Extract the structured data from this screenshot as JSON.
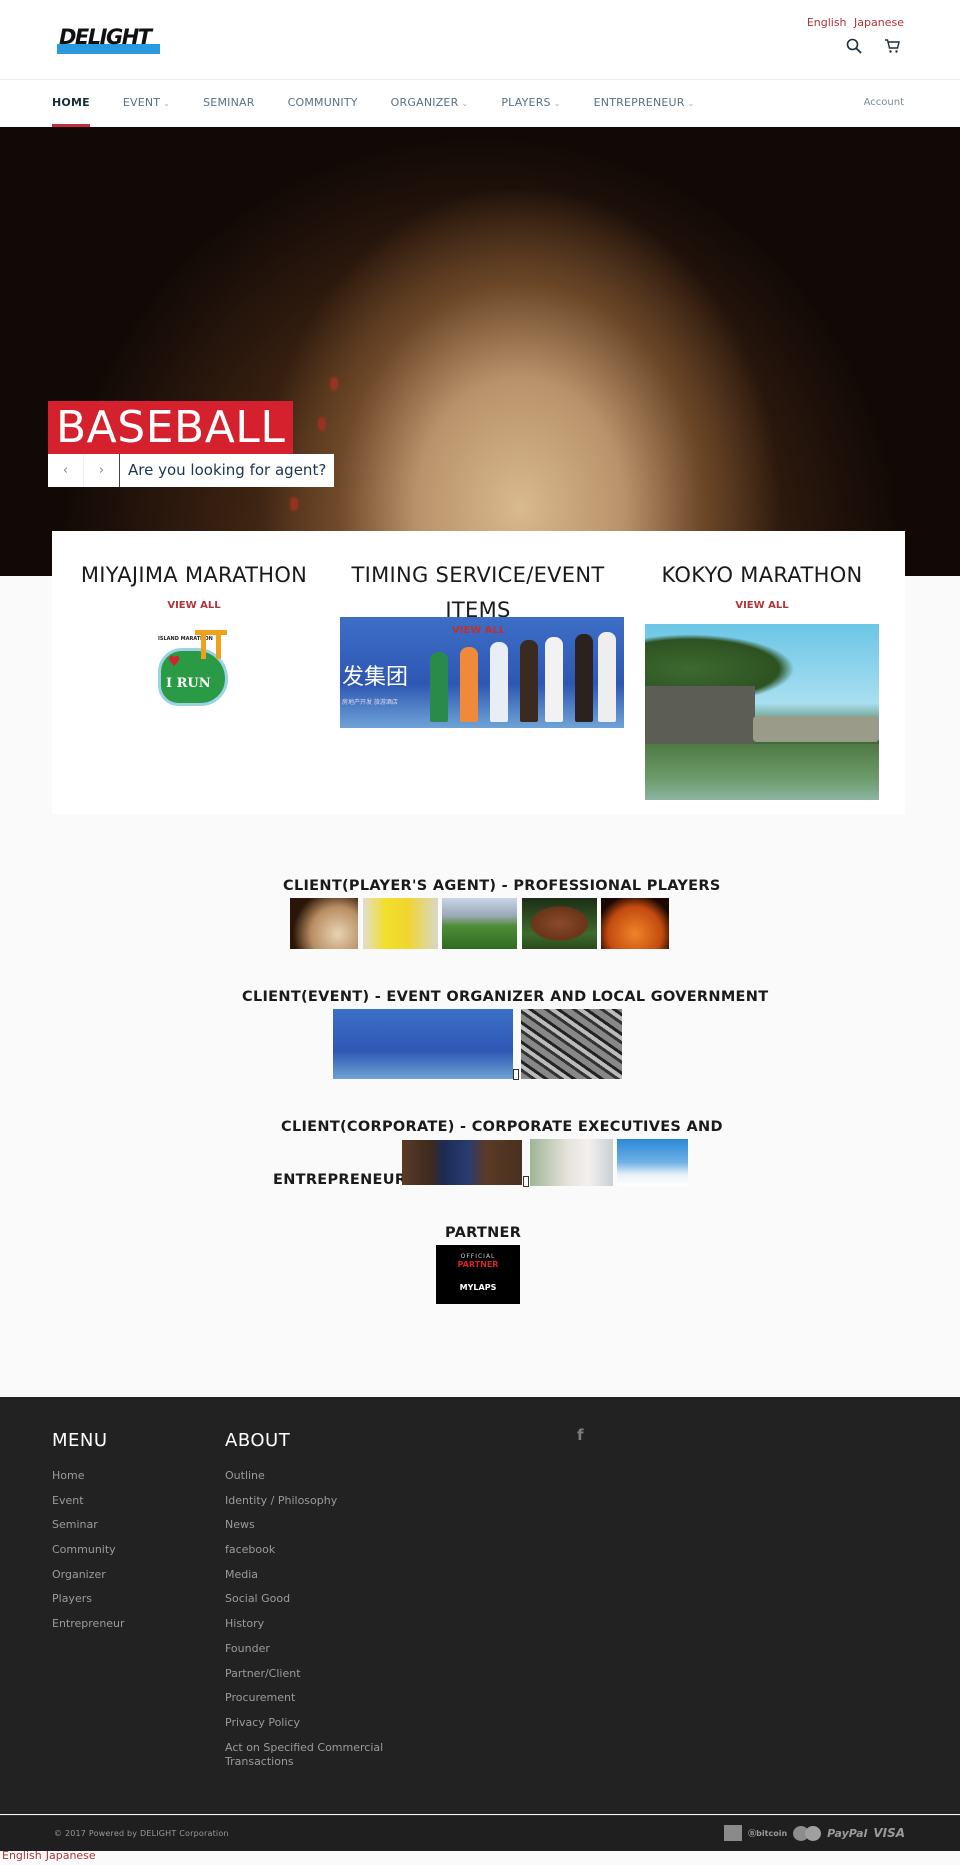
{
  "header": {
    "logo_text": "DELIGHT",
    "languages": [
      "English",
      "Japanese"
    ],
    "icons": [
      "search-icon",
      "cart-icon"
    ]
  },
  "nav": {
    "items": [
      {
        "label": "HOME",
        "active": true,
        "dropdown": false
      },
      {
        "label": "EVENT",
        "active": false,
        "dropdown": true
      },
      {
        "label": "SEMINAR",
        "active": false,
        "dropdown": false
      },
      {
        "label": "COMMUNITY",
        "active": false,
        "dropdown": false
      },
      {
        "label": "ORGANIZER",
        "active": false,
        "dropdown": true
      },
      {
        "label": "PLAYERS",
        "active": false,
        "dropdown": true
      },
      {
        "label": "ENTREPRENEUR",
        "active": false,
        "dropdown": true
      }
    ],
    "account": "Account"
  },
  "hero": {
    "title": "BASEBALL",
    "caption": "Are you looking for agent?",
    "prev": "‹",
    "next": "›"
  },
  "collections": [
    {
      "title": "MIYAJIMA MARATHON",
      "link": "VIEW ALL",
      "image": "island-marathon-i-run-logo",
      "logo_text": "I RUN",
      "logo_small": "ISLAND MARATHON"
    },
    {
      "title": "TIMING SERVICE/EVENT ITEMS",
      "link": "VIEW ALL",
      "image": "marathon-runners-start",
      "banner_text": "发集团",
      "banner_sub": "房地产开发 旅游酒店"
    },
    {
      "title": "KOKYO MARATHON",
      "link": "VIEW ALL",
      "image": "imperial-palace-bridge"
    }
  ],
  "clients": {
    "players": {
      "title": "CLIENT(PLAYER'S AGENT) - PROFESSIONAL PLAYERS",
      "images": [
        "baseball",
        "volleyball",
        "soccer",
        "american-football",
        "basketball"
      ]
    },
    "event": {
      "title": "CLIENT(EVENT) - EVENT ORGANIZER AND LOCAL GOVERNMENT",
      "images": [
        "marathon-runners",
        "photo-wall"
      ]
    },
    "corporate": {
      "title_line1": "CLIENT(CORPORATE) - CORPORATE EXECUTIVES AND",
      "title_line2": "ENTREPRENEUR",
      "images": [
        "businessman-suit",
        "woman-office",
        "man-laptop"
      ]
    },
    "partner": {
      "title": "PARTNER",
      "badge_official": "OFFICIAL",
      "badge_partner": "PARTNER",
      "badge_brand": "MYLAPS"
    }
  },
  "footer": {
    "menu": {
      "title": "MENU",
      "items": [
        "Home",
        "Event",
        "Seminar",
        "Community",
        "Organizer",
        "Players",
        "Entrepreneur"
      ]
    },
    "about": {
      "title": "ABOUT",
      "items": [
        "Outline",
        "Identity / Philosophy",
        "News",
        "facebook",
        "Media",
        "Social Good",
        "History",
        "Founder",
        "Partner/Client",
        "Procurement",
        "Privacy Policy",
        "Act on Specified Commercial Transactions"
      ]
    },
    "social": "f",
    "copyright": "© 2017 Powered by DELIGHT Corporation",
    "payments": [
      "american-express",
      "bitcoin",
      "master",
      "PayPal",
      "VISA"
    ],
    "bitcoin_label": "bitcoin",
    "paypal_label": "PayPal",
    "visa_label": "VISA"
  },
  "bottom_languages": [
    "English",
    "Japanese"
  ],
  "colors": {
    "accent_red": "#d5202e",
    "link_red": "#b0343a",
    "footer_bg": "#222223",
    "logo_blue": "#2a9ae0"
  }
}
